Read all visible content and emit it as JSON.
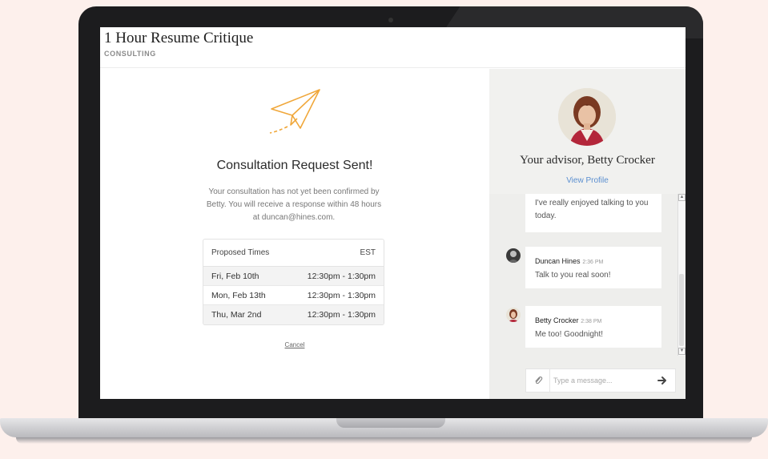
{
  "header": {
    "title": "1 Hour Resume Critique",
    "subtitle": "CONSULTING"
  },
  "confirmation": {
    "title": "Consultation Request Sent!",
    "body": "Your consultation has not yet been confirmed by Betty. You will receive a response within 48 hours at duncan@hines.com.",
    "icon": "paper-plane-icon",
    "accent_color": "#f0a73a"
  },
  "times": {
    "header_label": "Proposed Times",
    "timezone": "EST",
    "rows": [
      {
        "date": "Fri, Feb 10th",
        "time": "12:30pm - 1:30pm"
      },
      {
        "date": "Mon, Feb 13th",
        "time": "12:30pm - 1:30pm"
      },
      {
        "date": "Thu, Mar 2nd",
        "time": "12:30pm - 1:30pm"
      }
    ]
  },
  "cancel_label": "Cancel",
  "advisor": {
    "heading": "Your advisor, Betty Crocker",
    "view_profile_label": "View Profile",
    "link_color": "#5b8fd0"
  },
  "chat": {
    "messages": [
      {
        "author": "",
        "time": "",
        "text": "I've really enjoyed talking to you today."
      },
      {
        "author": "Duncan Hines",
        "time": "2:36 PM",
        "text": "Talk to you real soon!"
      },
      {
        "author": "Betty Crocker",
        "time": "2:38 PM",
        "text": "Me too! Goodnight!"
      }
    ],
    "compose_placeholder": "Type a message...",
    "attach_icon": "paperclip-icon",
    "send_icon": "arrow-right-icon"
  }
}
